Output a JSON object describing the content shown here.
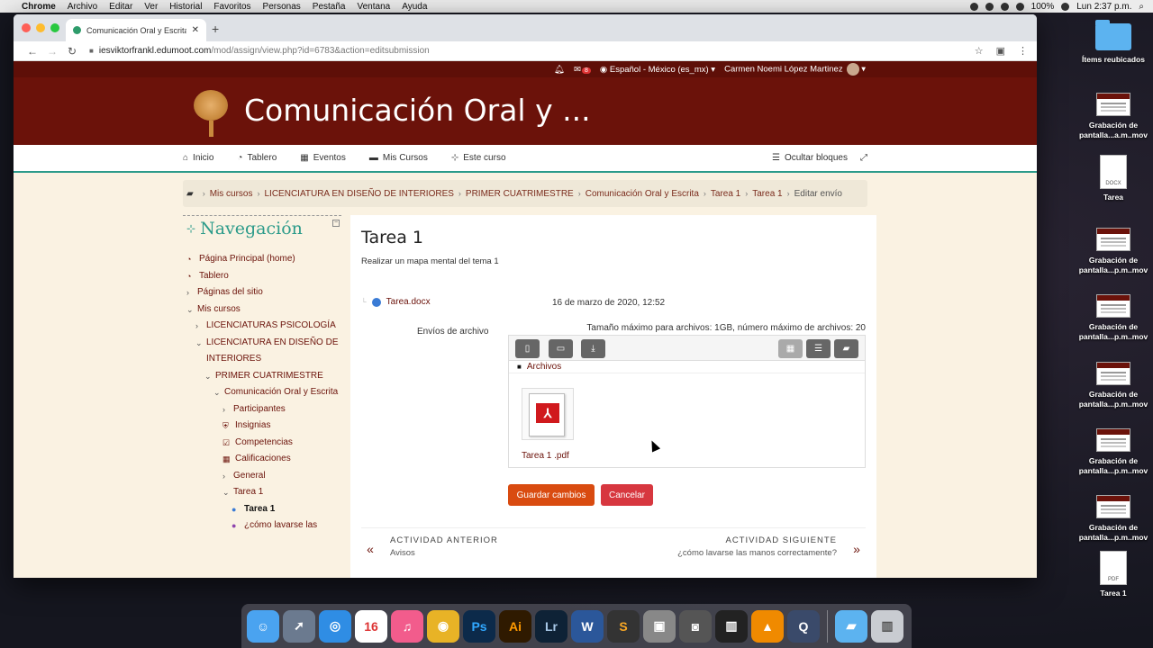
{
  "menubar": {
    "app": "Chrome",
    "items": [
      "Archivo",
      "Editar",
      "Ver",
      "Historial",
      "Favoritos",
      "Personas",
      "Pestaña",
      "Ventana",
      "Ayuda"
    ],
    "battery": "100%",
    "clock": "Lun 2:37 p.m."
  },
  "desktop": {
    "icons": [
      {
        "label": "Ítems reubicados",
        "type": "folder"
      },
      {
        "label": "Grabación de pantalla...a.m..mov",
        "type": "thumb"
      },
      {
        "label": "Tarea",
        "type": "doc",
        "ext": "DOCX"
      },
      {
        "label": "Grabación de pantalla...p.m..mov",
        "type": "thumb"
      },
      {
        "label": "Grabación de pantalla...p.m..mov",
        "type": "thumb"
      },
      {
        "label": "Grabación de pantalla...p.m..mov",
        "type": "thumb"
      },
      {
        "label": "Grabación de pantalla...p.m..mov",
        "type": "thumb"
      },
      {
        "label": "Grabación de pantalla...p.m..mov",
        "type": "thumb"
      },
      {
        "label": "Tarea 1",
        "type": "doc",
        "ext": "PDF"
      }
    ]
  },
  "browser": {
    "tab_title": "Comunicación Oral y Escrita: Tar",
    "url_host": "iesviktorfrankl.edumoot.com",
    "url_path": "/mod/assign/view.php?id=6783&action=editsubmission"
  },
  "site": {
    "notifications_badge": "8",
    "language": "Español - México (es_mx)",
    "user": "Carmen Noemi López Martinez",
    "course_title": "Comunicación Oral y ...",
    "nav": [
      "Inicio",
      "Tablero",
      "Eventos",
      "Mis Cursos",
      "Este curso"
    ],
    "hide_blocks": "Ocultar bloques",
    "breadcrumb": [
      "Mis cursos",
      "LICENCIATURA EN DISEÑO DE INTERIORES",
      "PRIMER CUATRIMESTRE",
      "Comunicación Oral y Escrita",
      "Tarea 1",
      "Tarea 1",
      "Editar envío"
    ]
  },
  "navblock": {
    "title": "Navegación",
    "items": [
      {
        "label": "Página Principal (home)",
        "indent": 0,
        "icon": "gauge",
        "chevron": ""
      },
      {
        "label": "Tablero",
        "indent": 0,
        "icon": "gauge",
        "chevron": ""
      },
      {
        "label": "Páginas del sitio",
        "indent": 0,
        "icon": "",
        "chevron": "›"
      },
      {
        "label": "Mis cursos",
        "indent": 0,
        "icon": "",
        "chevron": "⌄"
      },
      {
        "label": "LICENCIATURAS PSICOLOGÍA",
        "indent": 1,
        "icon": "",
        "chevron": "›"
      },
      {
        "label": "LICENCIATURA EN DISEÑO DE INTERIORES",
        "indent": 1,
        "icon": "",
        "chevron": "⌄"
      },
      {
        "label": "PRIMER CUATRIMESTRE",
        "indent": 2,
        "icon": "",
        "chevron": "⌄"
      },
      {
        "label": "Comunicación Oral y Escrita",
        "indent": 3,
        "icon": "",
        "chevron": "⌄"
      },
      {
        "label": "Participantes",
        "indent": 4,
        "icon": "",
        "chevron": "›"
      },
      {
        "label": "Insignias",
        "indent": 4,
        "icon": "shield",
        "chevron": ""
      },
      {
        "label": "Competencias",
        "indent": 4,
        "icon": "check",
        "chevron": ""
      },
      {
        "label": "Calificaciones",
        "indent": 4,
        "icon": "table",
        "chevron": ""
      },
      {
        "label": "General",
        "indent": 4,
        "icon": "",
        "chevron": "›"
      },
      {
        "label": "Tarea 1",
        "indent": 4,
        "icon": "",
        "chevron": "⌄"
      },
      {
        "label": "Tarea 1",
        "indent": 5,
        "icon": "assign",
        "chevron": "",
        "active": true
      },
      {
        "label": "¿cómo lavarse las",
        "indent": 5,
        "icon": "quiz",
        "chevron": ""
      }
    ]
  },
  "main": {
    "heading": "Tarea 1",
    "intro": "Realizar un mapa mental del tema 1",
    "attachment_name": "Tarea.docx",
    "attachment_date": "16 de marzo de 2020, 12:52",
    "files_label": "Envíos de archivo",
    "max_info": "Tamaño máximo para archivos: 1GB, número máximo de archivos: 20",
    "folder_path": "Archivos",
    "file_name": "Tarea 1 .pdf",
    "save_label": "Guardar cambios",
    "cancel_label": "Cancelar",
    "prev_label": "ACTIVIDAD ANTERIOR",
    "prev_sub": "Avisos",
    "next_label": "ACTIVIDAD SIGUIENTE",
    "next_sub": "¿cómo lavarse las manos correctamente?"
  },
  "colors": {
    "header": "#6b120a",
    "accent": "#2c9b8a",
    "save": "#d94b10",
    "cancel": "#d7373f"
  }
}
